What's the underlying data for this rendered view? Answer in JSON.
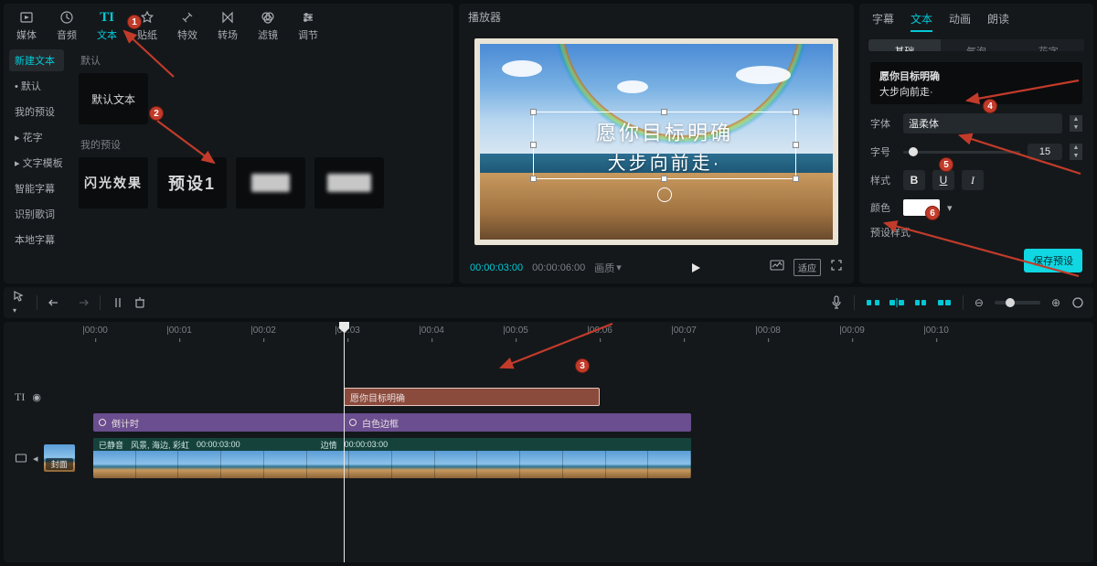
{
  "topTabs": {
    "media": "媒体",
    "audio": "音频",
    "text": "文本",
    "sticker": "贴纸",
    "effect": "特效",
    "transition": "转场",
    "filter": "滤镜",
    "adjust": "调节",
    "active": "text"
  },
  "sideCats": {
    "newText": "新建文本",
    "default": "默认",
    "myPreset": "我的预设",
    "fancy": "花字",
    "textTemplate": "文字模板",
    "smartCaption": "智能字幕",
    "lyrics": "识别歌词",
    "localCaption": "本地字幕",
    "active": "newText"
  },
  "group1Label": "默认",
  "defaultTextCard": "默认文本",
  "group2Label": "我的预设",
  "presets": {
    "p1": "闪光效果",
    "p2": "预设1"
  },
  "player": {
    "title": "播放器",
    "cur": "00:00:03:00",
    "tot": "00:00:06:00",
    "quality": "画质",
    "btnRatio": "适应",
    "overlayLine1": "愿你目标明确",
    "overlayLine2": "大步向前走·"
  },
  "propsTabs": {
    "caption": "字幕",
    "text": "文本",
    "anim": "动画",
    "read": "朗读",
    "active": "text"
  },
  "subTabs": {
    "basic": "基础",
    "bubble": "气泡",
    "fancy": "花字",
    "active": "basic"
  },
  "props": {
    "textLine1": "愿你目标明确",
    "textLine2": "       大步向前走·",
    "fontLabel": "字体",
    "fontValue": "温柔体",
    "sizeLabel": "字号",
    "sizeValue": "15",
    "styleLabel": "样式",
    "boldLetter": "B",
    "underlineLetter": "U",
    "italicLetter": "I",
    "colorLabel": "颜色",
    "colorValue": "#ffffff",
    "presetStyleLabel": "预设样式",
    "savePreset": "保存预设"
  },
  "toolbar": {
    "audio": "mic"
  },
  "timeline": {
    "ruler": [
      "00:00",
      "00:01",
      "00:02",
      "00:03",
      "00:04",
      "00:05",
      "00:06",
      "00:07",
      "00:08",
      "00:09",
      "00:10"
    ],
    "textClip": "愿你目标明确",
    "fx1": "倒计时",
    "fx2": "白色边框",
    "videoMute": "已静音",
    "videoName": "风景, 海边, 彩虹",
    "videoDur": "00:00:03:00",
    "fx2Dur": "00:00:03:00",
    "videoSeg2": "边情",
    "cover": "封面"
  },
  "marks": {
    "m1": "1",
    "m2": "2",
    "m3": "3",
    "m4": "4",
    "m5": "5",
    "m6": "6"
  }
}
